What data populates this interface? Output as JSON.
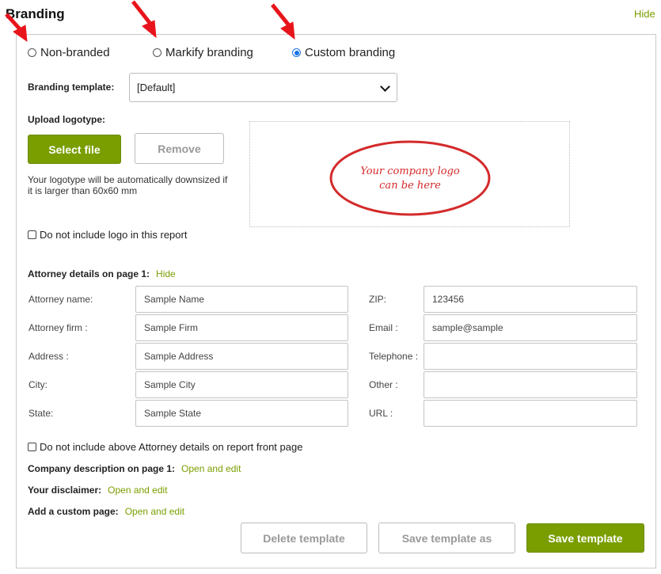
{
  "header": {
    "title": "Branding",
    "hide_label": "Hide"
  },
  "branding_options": [
    {
      "label": "Non-branded",
      "selected": false
    },
    {
      "label": "Markify branding",
      "selected": false
    },
    {
      "label": "Custom branding",
      "selected": true
    }
  ],
  "template": {
    "label": "Branding template:",
    "value": "[Default]"
  },
  "upload": {
    "label": "Upload logotype:",
    "select_file": "Select file",
    "remove": "Remove",
    "note": "Your logotype will be automatically downsized if it is larger than 60x60 mm",
    "placeholder_line1": "Your company logo",
    "placeholder_line2": "can be here"
  },
  "exclude_logo_label": "Do not include logo in this report",
  "attorney": {
    "heading": "Attorney details on page 1:",
    "hide_label": "Hide",
    "left": [
      {
        "label": "Attorney name:",
        "value": "Sample Name"
      },
      {
        "label": "Attorney firm :",
        "value": "Sample Firm"
      },
      {
        "label": "Address :",
        "value": "Sample Address"
      },
      {
        "label": "City:",
        "value": "Sample City"
      },
      {
        "label": "State:",
        "value": "Sample State"
      }
    ],
    "right": [
      {
        "label": "ZIP:",
        "value": "123456"
      },
      {
        "label": "Email :",
        "value": "sample@sample"
      },
      {
        "label": "Telephone :",
        "value": ""
      },
      {
        "label": "Other :",
        "value": ""
      },
      {
        "label": "URL :",
        "value": ""
      }
    ]
  },
  "exclude_attorney_label": "Do not include above Attorney details on report front page",
  "company_description": {
    "label": "Company description on page 1:",
    "link": "Open and edit"
  },
  "disclaimer": {
    "label": "Your disclaimer:",
    "link": "Open and edit"
  },
  "custom_page": {
    "label": "Add a custom page:",
    "link": "Open and edit"
  },
  "actions": {
    "delete": "Delete template",
    "save_as": "Save template as",
    "save": "Save template"
  },
  "colors": {
    "accent": "#7a9e00",
    "radio_selected": "#1a73e8",
    "annotation_arrow": "#e8141b",
    "logo_placeholder": "#d42a2a"
  }
}
